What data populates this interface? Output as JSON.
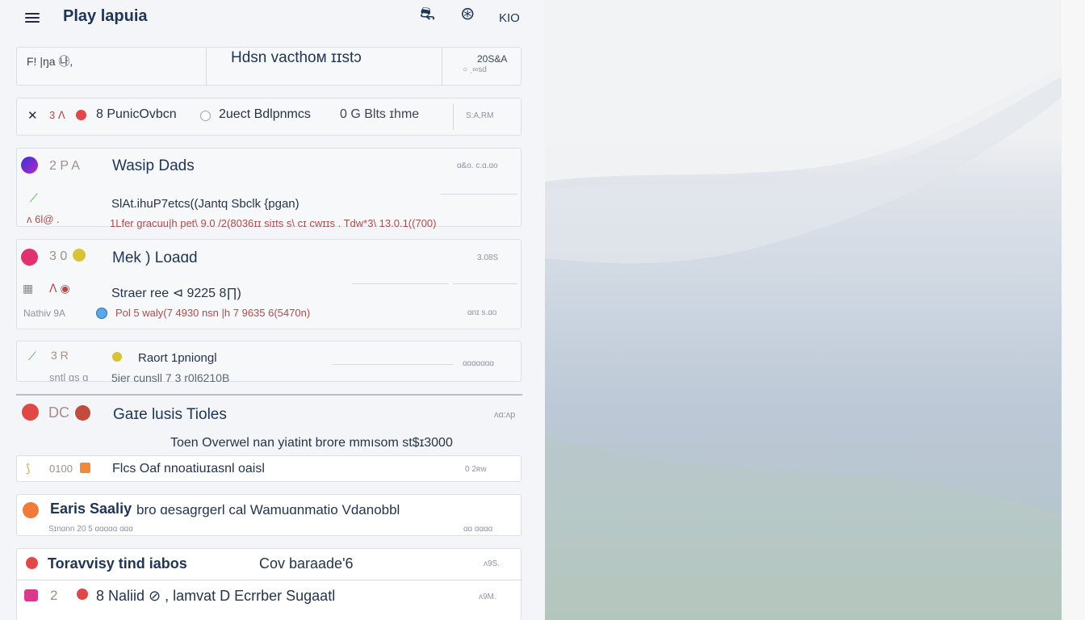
{
  "header": {
    "menu_icon": "hamburger-icon",
    "title": "Plау lapuia",
    "icon1": "⛐",
    "icon2": "⊛",
    "text": "KIO"
  },
  "summary": {
    "left_text": "F! |ŋa ㉯,",
    "center_text": "Hdsn vacthoм ɪɪstɔ",
    "right_top": "20S&A",
    "right_bottom": "○ ˌ∞sd"
  },
  "filter": {
    "close": "✕",
    "nums": "3 ᐱ",
    "label": "8  PunicOvbcn",
    "label2": "2uect Bdlpnmcs",
    "extra": "0 G  Blts ɪhme",
    "right": "S:A,RM"
  },
  "row1": {
    "nums": "2 P A",
    "title": "Wasip Dads",
    "right": "ɑ&o. c.ɑ.ɑo",
    "sub": "SlAt.ihuP7etcs((Jantq Sbclk {pgan)",
    "sub2": "1Lfer gracuu|h pet\\ 9.0 /2(8036ɪɪ siɪts s\\ cɪ cwɪɪs . Tdw*3\\ 13.0.1((700)",
    "meta": "ᴧ 6l@ ."
  },
  "row2": {
    "nums": "3 0",
    "title": "Mek ) Loaɑd",
    "right": "3.08S",
    "sub": "Straer ree ⊲ 9225 8∏)",
    "sub2": "Pol 5 waly(7 4930 nsn |h 7 9635 6(5470n)",
    "meta": "Nathiv 9A ",
    "right2": "ɑnɪ s.ɑo"
  },
  "row3": {
    "nums": "3 R",
    "title": "Raort 1pniongl",
    "sub": "5ier cunsll 7 3 r0l6210B",
    "meta": "sntl ɑs ɑ",
    "right": "ɑɑɑɑɑɑɑ"
  },
  "section": {
    "nums": "DC",
    "title": "Gaɪe lusis Tioles",
    "right": "ʌɑ:ʌp",
    "note": "Toen Overwel nan yiatint brore mmısom st$ɪ3000"
  },
  "item1": {
    "nums": "0100",
    "label": "Flcs  Oaf nnoatiuɪasnl oaisl",
    "right": "0 2ʀw"
  },
  "item2": {
    "title": "Earis Saaliy",
    "text": "bro ɑesagrgerl cal  Wamuɑnmatio  Vdanobbl",
    "meta": "Sɪnɑnn 20  5 ɑɑɑɑɑ ɑɑɑ",
    "right": "ɑɑ ɑɑɑɑ"
  },
  "item3": {
    "title": "Toravvisy tind iabos",
    "mid": "Cov  baraade'6",
    "right": "ʌ9S."
  },
  "item4": {
    "nums": "2",
    "label": "8  Naliid ⊘ , lamvat  D  Ecrrber Sugaatl",
    "right": "ʌ9M."
  },
  "colors": {
    "accent": "#1e3555",
    "avatar_purple": "#6a2fd1",
    "avatar_pink": "#e0336e",
    "avatar_red": "#e04848",
    "avatar_orange": "#ef7a3a"
  }
}
